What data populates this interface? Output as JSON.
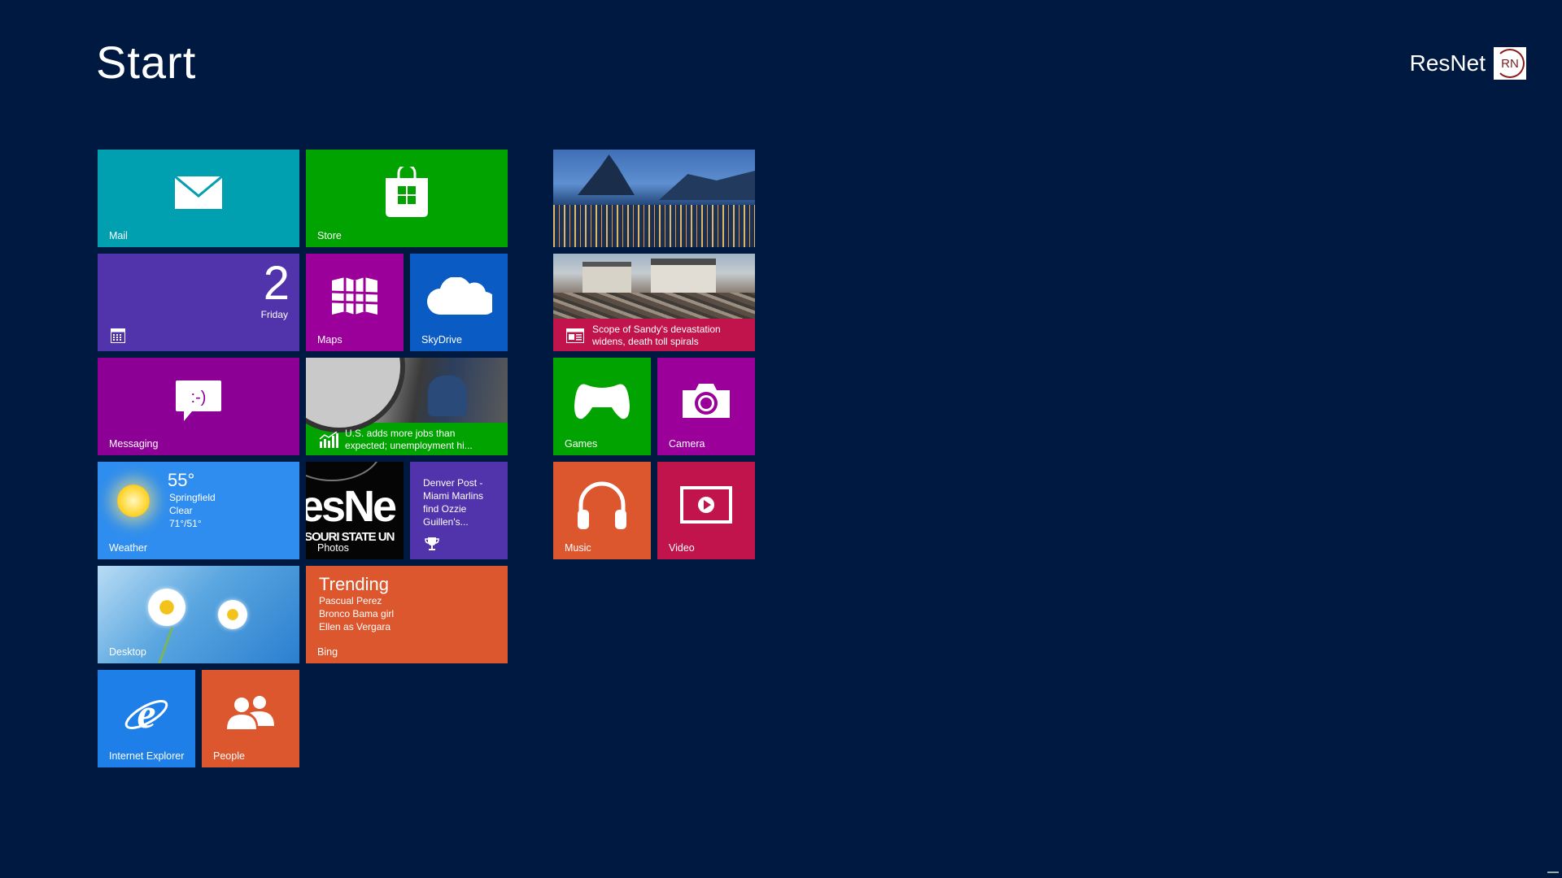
{
  "screen": {
    "title": "Start"
  },
  "user": {
    "name": "ResNet",
    "avatar_initials": "RN"
  },
  "tiles": {
    "mail": {
      "label": "Mail",
      "color": "#00A0B1",
      "icon": "mail-icon"
    },
    "store": {
      "label": "Store",
      "color": "#00A300",
      "icon": "store-bag-icon"
    },
    "calendar": {
      "day": "2",
      "weekday": "Friday",
      "color": "#5133AB",
      "icon": "calendar-icon"
    },
    "maps": {
      "label": "Maps",
      "color": "#9B009B",
      "icon": "map-icon"
    },
    "skydrive": {
      "label": "SkyDrive",
      "color": "#0A5BC4",
      "icon": "cloud-icon"
    },
    "messaging": {
      "label": "Messaging",
      "color": "#8C0095",
      "icon": "messaging-icon",
      "glyph": ":-)"
    },
    "finance": {
      "headline": "U.S. adds more jobs than expected; unemployment hi...",
      "color": "#00A300",
      "icon": "chart-icon"
    },
    "weather": {
      "temp": "55°",
      "city": "Springfield",
      "condition": "Clear",
      "range": "71°/51°",
      "label": "Weather",
      "color": "#2E8DEF",
      "icon": "sun-icon"
    },
    "photos": {
      "label": "Photos",
      "photo_text_top": "esNe",
      "photo_text_bottom": "SOURI STATE UN"
    },
    "sports": {
      "headline": "Denver Post - Miami Marlins find Ozzie Guillen's...",
      "color": "#5133AB",
      "icon": "trophy-icon"
    },
    "desktop": {
      "label": "Desktop"
    },
    "bing": {
      "title": "Trending",
      "items": [
        "Pascual Perez",
        "Bronco Bama girl",
        "Ellen as Vergara"
      ],
      "label": "Bing",
      "color": "#DC572E"
    },
    "ie": {
      "label": "Internet Explorer",
      "color": "#1E7FE8",
      "icon": "internet-explorer-icon"
    },
    "people": {
      "label": "People",
      "color": "#DC572E",
      "icon": "people-icon"
    },
    "travel": {
      "icon": "travel-photo"
    },
    "news": {
      "headline": "Scope of Sandy's devastation widens, death toll spirals",
      "color": "#C1144D",
      "icon": "newspaper-icon"
    },
    "games": {
      "label": "Games",
      "color": "#00A300",
      "icon": "gamepad-icon"
    },
    "camera": {
      "label": "Camera",
      "color": "#9B009B",
      "icon": "camera-icon"
    },
    "music": {
      "label": "Music",
      "color": "#DC572E",
      "icon": "headphones-icon"
    },
    "video": {
      "label": "Video",
      "color": "#C1144D",
      "icon": "video-icon"
    }
  }
}
